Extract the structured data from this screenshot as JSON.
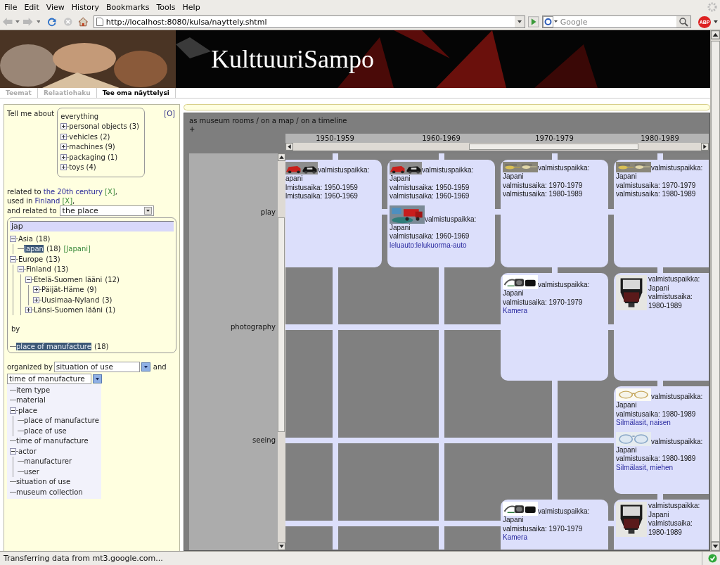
{
  "browser": {
    "menu": [
      "File",
      "Edit",
      "View",
      "History",
      "Bookmarks",
      "Tools",
      "Help"
    ],
    "url": "http://localhost:8080/kulsa/nayttely.shtml",
    "search": {
      "placeholder": "Google"
    },
    "addon_badge": "ABP"
  },
  "banner": {
    "title": "KulttuuriSampo",
    "background": {
      "kind": "picture"
    }
  },
  "tabs": [
    {
      "label": "Teemat",
      "selected": false
    },
    {
      "label": "Relaatiohaku",
      "selected": false
    },
    {
      "label": "Tee oma näyttelysi",
      "selected": true
    }
  ],
  "query": {
    "intro": "Tell me about",
    "reset": "[O]",
    "topic": {
      "label": "everything",
      "children": [
        {
          "label": "personal objects (3)",
          "expanded": false
        },
        {
          "label": "vehicles (2)",
          "expanded": false
        },
        {
          "label": "machines (9)",
          "expanded": false
        },
        {
          "label": "packaging (1)",
          "expanded": false
        },
        {
          "label": "toys (4)",
          "expanded": false
        }
      ]
    },
    "filters": [
      {
        "prefix": "related to",
        "value": "the 20th century",
        "remove": "[X]",
        "suffix": ","
      },
      {
        "prefix": "used in",
        "value": "Finland",
        "remove": "[X]",
        "suffix": ","
      }
    ],
    "relation": {
      "label": "and related to",
      "value": "the place"
    },
    "place_search": {
      "value": "jap"
    },
    "place_tree": [
      {
        "label": "Asia",
        "count": "(18)",
        "expanded": true,
        "selected": false,
        "children": [
          {
            "label": "Japan",
            "count": "(18)",
            "note": "[Japani]",
            "selected": true
          }
        ]
      },
      {
        "label": "Europe",
        "count": "(13)",
        "expanded": true,
        "selected": false,
        "children": [
          {
            "label": "Finland",
            "count": "(13)",
            "expanded": true,
            "selected": false,
            "children": [
              {
                "label": "Etelä-Suomen lääni",
                "count": "(12)",
                "expanded": true,
                "selected": false,
                "children": [
                  {
                    "label": "Päijät-Häme",
                    "count": "(9)",
                    "expanded": false,
                    "selected": false
                  },
                  {
                    "label": "Uusimaa-Nyland",
                    "count": "(3)",
                    "expanded": false,
                    "selected": false
                  }
                ]
              },
              {
                "label": "Länsi-Suomen lääni",
                "count": "(1)",
                "expanded": false,
                "selected": false
              }
            ]
          }
        ]
      }
    ],
    "by_label": "by",
    "by_tree": [
      {
        "label": "place of manufacture",
        "count": "(18)",
        "selected": true
      }
    ],
    "organize": {
      "label": "organized by",
      "first": "situation of use",
      "joiner": "and",
      "second": "time of manufacture",
      "options": [
        {
          "label": "item type",
          "selected": false
        },
        {
          "label": "material",
          "selected": false
        },
        {
          "label": "place",
          "expanded": true,
          "selected": false,
          "children": [
            {
              "label": "place of manufacture",
              "selected": false
            },
            {
              "label": "place of use",
              "selected": false
            }
          ]
        },
        {
          "label": "time of manufacture",
          "selected": false
        },
        {
          "label": "actor",
          "expanded": true,
          "selected": false,
          "children": [
            {
              "label": "manufacturer",
              "selected": false
            },
            {
              "label": "user",
              "selected": false
            }
          ]
        },
        {
          "label": "situation of use",
          "selected": false
        },
        {
          "label": "museum collection",
          "selected": false
        }
      ]
    }
  },
  "view": {
    "modes": "as museum rooms / on a map / on a timeline",
    "add": "+",
    "columns": [
      "1950-1959",
      "1960-1969",
      "1970-1979",
      "1980-1989"
    ],
    "rows": [
      {
        "label": "play",
        "cells": [
          {
            "items": [
              {
                "kind": "inline",
                "image": {
                  "kind": "picture"
                },
                "lines": [
                  "valmistuspaikka:",
                  "apani",
                  "lmistusaika: 1950-1959",
                  "lmistusaika: 1960-1969"
                ]
              }
            ]
          },
          {
            "items": [
              {
                "kind": "inline",
                "image": {
                  "kind": "picture"
                },
                "lines": [
                  "valmistuspaikka:",
                  "Japani",
                  "valmistusaika: 1950-1959",
                  "valmistusaika: 1960-1969"
                ]
              },
              {
                "kind": "inline",
                "image": {
                  "kind": "picture"
                },
                "lines": [
                  "valmistuspaikka:",
                  "Japani",
                  "valmistusaika: 1960-1969"
                ],
                "link": "leluauto:lelukuorma-auto"
              }
            ]
          },
          {
            "items": [
              {
                "kind": "inline",
                "image": {
                  "kind": "picture"
                },
                "lines": [
                  "valmistuspaikka:",
                  "Japani",
                  "valmistusaika: 1970-1979",
                  "valmistusaika: 1980-1989"
                ]
              }
            ]
          },
          {
            "items": [
              {
                "kind": "inline",
                "image": {
                  "kind": "picture"
                },
                "lines": [
                  "valmistuspaikka:",
                  "Japani",
                  "valmistusaika: 1970-1979",
                  "valmistusaika: 1980-1989"
                ]
              }
            ]
          }
        ]
      },
      {
        "label": "photography",
        "cells": [
          null,
          null,
          {
            "items": [
              {
                "kind": "inline",
                "image": {
                  "kind": "picture"
                },
                "lines": [
                  "valmistuspaikka:",
                  "Japani",
                  "valmistusaika: 1970-1979"
                ],
                "link": "Kamera"
              }
            ]
          },
          {
            "items": [
              {
                "kind": "aside",
                "image": {
                  "kind": "picture"
                },
                "lines": [
                  "valmistuspaikka:",
                  "Japani",
                  "valmistusaika:",
                  "1980-1989"
                ]
              }
            ]
          }
        ]
      },
      {
        "label": "seeing",
        "cells": [
          null,
          null,
          null,
          {
            "items": [
              {
                "kind": "inline",
                "image": {
                  "kind": "picture"
                },
                "lines": [
                  "valmistuspaikka:",
                  "Japani",
                  "valmistusaika: 1980-1989"
                ],
                "link": "Silmälasit, naisen"
              },
              {
                "kind": "inline",
                "image": {
                  "kind": "picture"
                },
                "lines": [
                  "valmistuspaikka:",
                  "Japani",
                  "valmistusaika: 1980-1989"
                ],
                "link": "Silmälasit, miehen"
              }
            ]
          }
        ]
      },
      {
        "cells": [
          null,
          null,
          {
            "items": [
              {
                "kind": "inline",
                "image": {
                  "kind": "picture"
                },
                "lines": [
                  "valmistuspaikka:",
                  "Japani",
                  "valmistusaika: 1970-1979"
                ],
                "link": "Kamera"
              }
            ]
          },
          {
            "items": [
              {
                "kind": "aside",
                "image": {
                  "kind": "picture"
                },
                "lines": [
                  "valmistuspaikka:",
                  "Japani",
                  "valmistusaika:",
                  "1980-1989"
                ]
              }
            ]
          }
        ]
      }
    ]
  },
  "status_bar": {
    "text": "Transferring data from mt3.google.com..."
  }
}
